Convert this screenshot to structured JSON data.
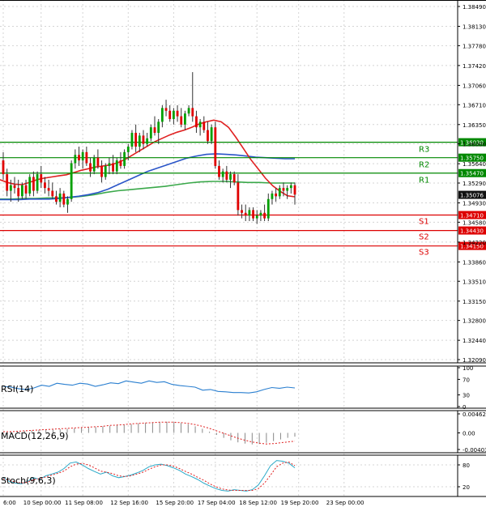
{
  "colors": {
    "up": "#00a000",
    "down": "#e00000",
    "wick": "#333333",
    "ma_fast": "#e02020",
    "ma_mid": "#2a55c8",
    "ma_slow": "#3aa84a",
    "resistance": "#008800",
    "support": "#dd0000",
    "rsi": "#2a7fd0",
    "macd_hist": "#888888",
    "macd_signal": "#e02020",
    "stoch_k": "#2aa9c8",
    "stoch_d": "#e02020",
    "grid": "#d4d4d4",
    "current_price_bg": "#111111"
  },
  "chart_data": [
    {
      "type": "candlestick",
      "title": "",
      "ylim": [
        1.3209,
        1.3849
      ],
      "y_ticks": [
        "1.38490",
        "1.38130",
        "1.37780",
        "1.37420",
        "1.37060",
        "1.36710",
        "1.36350",
        "1.36000",
        "1.35640",
        "1.35290",
        "1.34930",
        "1.34580",
        "1.34220",
        "1.33860",
        "1.33510",
        "1.33150",
        "1.32800",
        "1.32440",
        "1.32090"
      ],
      "x_ticks": [
        "6:00",
        "10 Sep 00:00",
        "11 Sep 08:00",
        "12 Sep 16:00",
        "15 Sep 20:00",
        "17 Sep 04:00",
        "18 Sep 12:00",
        "19 Sep 20:00",
        "23 Sep 00:00"
      ],
      "x_tick_index": [
        0,
        10,
        21,
        33,
        45,
        56,
        67,
        78,
        90
      ],
      "current_price": "1.35076",
      "levels": [
        {
          "name": "R3",
          "value": 1.3603,
          "label": "1.36030",
          "kind": "resistance"
        },
        {
          "name": "R2",
          "value": 1.3575,
          "label": "1.35750",
          "kind": "resistance"
        },
        {
          "name": "R1",
          "value": 1.3547,
          "label": "1.35470",
          "kind": "resistance"
        },
        {
          "name": "S1",
          "value": 1.3471,
          "label": "1.34710",
          "kind": "support"
        },
        {
          "name": "S2",
          "value": 1.3443,
          "label": "1.34430",
          "kind": "support"
        },
        {
          "name": "S3",
          "value": 1.3415,
          "label": "1.34150",
          "kind": "support"
        }
      ],
      "candles": [
        [
          1.357,
          1.3585,
          1.3535,
          1.3545
        ],
        [
          1.3545,
          1.3555,
          1.3505,
          1.3515
        ],
        [
          1.3515,
          1.3535,
          1.3495,
          1.3525
        ],
        [
          1.3525,
          1.354,
          1.351,
          1.352
        ],
        [
          1.352,
          1.3535,
          1.3495,
          1.3505
        ],
        [
          1.3505,
          1.353,
          1.35,
          1.3525
        ],
        [
          1.3525,
          1.3535,
          1.35,
          1.351
        ],
        [
          1.351,
          1.3545,
          1.3505,
          1.354
        ],
        [
          1.354,
          1.355,
          1.3505,
          1.3515
        ],
        [
          1.3515,
          1.355,
          1.351,
          1.3545
        ],
        [
          1.3545,
          1.356,
          1.352,
          1.353
        ],
        [
          1.353,
          1.354,
          1.351,
          1.352
        ],
        [
          1.352,
          1.3535,
          1.3505,
          1.3515
        ],
        [
          1.3515,
          1.353,
          1.35,
          1.3505
        ],
        [
          1.3505,
          1.3515,
          1.349,
          1.3495
        ],
        [
          1.3495,
          1.352,
          1.3485,
          1.351
        ],
        [
          1.351,
          1.3515,
          1.3485,
          1.349
        ],
        [
          1.349,
          1.3505,
          1.3475,
          1.35
        ],
        [
          1.35,
          1.357,
          1.3495,
          1.3565
        ],
        [
          1.3565,
          1.359,
          1.3555,
          1.358
        ],
        [
          1.358,
          1.3595,
          1.356,
          1.357
        ],
        [
          1.357,
          1.359,
          1.3555,
          1.3585
        ],
        [
          1.3585,
          1.3595,
          1.356,
          1.3565
        ],
        [
          1.3565,
          1.3575,
          1.354,
          1.355
        ],
        [
          1.355,
          1.358,
          1.3545,
          1.3575
        ],
        [
          1.3575,
          1.359,
          1.3555,
          1.356
        ],
        [
          1.356,
          1.357,
          1.353,
          1.354
        ],
        [
          1.354,
          1.3565,
          1.3535,
          1.356
        ],
        [
          1.356,
          1.3575,
          1.3545,
          1.3565
        ],
        [
          1.3565,
          1.358,
          1.3545,
          1.355
        ],
        [
          1.355,
          1.3575,
          1.3545,
          1.357
        ],
        [
          1.357,
          1.3585,
          1.3555,
          1.356
        ],
        [
          1.356,
          1.359,
          1.3555,
          1.3585
        ],
        [
          1.3585,
          1.36,
          1.357,
          1.3595
        ],
        [
          1.3595,
          1.3625,
          1.359,
          1.362
        ],
        [
          1.362,
          1.3635,
          1.3585,
          1.3595
        ],
        [
          1.3595,
          1.362,
          1.3585,
          1.3615
        ],
        [
          1.3615,
          1.3625,
          1.359,
          1.36
        ],
        [
          1.36,
          1.362,
          1.3595,
          1.361
        ],
        [
          1.361,
          1.3635,
          1.3605,
          1.363
        ],
        [
          1.363,
          1.365,
          1.3615,
          1.362
        ],
        [
          1.362,
          1.3645,
          1.36,
          1.364
        ],
        [
          1.364,
          1.367,
          1.363,
          1.3665
        ],
        [
          1.3665,
          1.368,
          1.365,
          1.366
        ],
        [
          1.366,
          1.367,
          1.364,
          1.3645
        ],
        [
          1.3645,
          1.3665,
          1.3635,
          1.366
        ],
        [
          1.366,
          1.367,
          1.364,
          1.365
        ],
        [
          1.365,
          1.3665,
          1.363,
          1.3635
        ],
        [
          1.3635,
          1.366,
          1.3625,
          1.3655
        ],
        [
          1.3655,
          1.367,
          1.365,
          1.3665
        ],
        [
          1.3665,
          1.373,
          1.364,
          1.365
        ],
        [
          1.365,
          1.366,
          1.362,
          1.363
        ],
        [
          1.363,
          1.3645,
          1.3615,
          1.364
        ],
        [
          1.364,
          1.365,
          1.362,
          1.3625
        ],
        [
          1.3625,
          1.364,
          1.36,
          1.3605
        ],
        [
          1.3605,
          1.3635,
          1.36,
          1.363
        ],
        [
          1.363,
          1.364,
          1.3555,
          1.356
        ],
        [
          1.356,
          1.357,
          1.3535,
          1.354
        ],
        [
          1.354,
          1.3555,
          1.353,
          1.355
        ],
        [
          1.355,
          1.356,
          1.353,
          1.3535
        ],
        [
          1.3535,
          1.355,
          1.352,
          1.3545
        ],
        [
          1.3545,
          1.355,
          1.3525,
          1.353
        ],
        [
          1.353,
          1.3545,
          1.347,
          1.348
        ],
        [
          1.348,
          1.349,
          1.3465,
          1.3475
        ],
        [
          1.3475,
          1.349,
          1.346,
          1.347
        ],
        [
          1.347,
          1.3485,
          1.346,
          1.348
        ],
        [
          1.348,
          1.3485,
          1.346,
          1.3465
        ],
        [
          1.3465,
          1.348,
          1.3455,
          1.347
        ],
        [
          1.347,
          1.348,
          1.346,
          1.3475
        ],
        [
          1.3475,
          1.349,
          1.346,
          1.3465
        ],
        [
          1.3465,
          1.351,
          1.346,
          1.35
        ],
        [
          1.35,
          1.3515,
          1.349,
          1.351
        ],
        [
          1.351,
          1.352,
          1.3495,
          1.3505
        ],
        [
          1.3505,
          1.3525,
          1.35,
          1.352
        ],
        [
          1.352,
          1.353,
          1.3505,
          1.3515
        ],
        [
          1.3515,
          1.3525,
          1.35,
          1.352
        ],
        [
          1.352,
          1.353,
          1.351,
          1.3525
        ],
        [
          1.3525,
          1.353,
          1.349,
          1.3508
        ]
      ],
      "ma_fast": [
        1.3535,
        1.353,
        1.3527,
        1.3526,
        1.353,
        1.3535,
        1.3538,
        1.354,
        1.3542,
        1.3544,
        1.3548,
        1.3552,
        1.3555,
        1.3558,
        1.356,
        1.3562,
        1.3566,
        1.3572,
        1.358,
        1.3588,
        1.3596,
        1.3604,
        1.361,
        1.3616,
        1.3621,
        1.3625,
        1.363,
        1.3636,
        1.364,
        1.3643,
        1.364,
        1.363,
        1.3612,
        1.3592,
        1.3572,
        1.3555,
        1.3538,
        1.3524,
        1.3514,
        1.3506,
        1.3504
      ],
      "ma_mid": [
        1.3499,
        1.3499,
        1.3499,
        1.35,
        1.35,
        1.35,
        1.3501,
        1.3503,
        1.3505,
        1.3508,
        1.3512,
        1.3518,
        1.3526,
        1.3534,
        1.3542,
        1.355,
        1.3556,
        1.3562,
        1.3568,
        1.3574,
        1.3578,
        1.3581,
        1.3582,
        1.3581,
        1.358,
        1.3578,
        1.3576,
        1.3575,
        1.3574,
        1.3573,
        1.3573
      ],
      "ma_slow": [
        1.35,
        1.35,
        1.3501,
        1.3501,
        1.3502,
        1.3502,
        1.3503,
        1.3505,
        1.3508,
        1.3512,
        1.3515,
        1.3517,
        1.3519,
        1.3521,
        1.3523,
        1.3526,
        1.3529,
        1.3531,
        1.3532,
        1.3532,
        1.3531,
        1.353,
        1.353,
        1.3529,
        1.3529,
        1.3529
      ]
    },
    {
      "type": "line",
      "name": "RSI(14)",
      "ylim": [
        0,
        100
      ],
      "y_ticks": [
        "100",
        "70",
        "30",
        "0"
      ],
      "values": [
        52,
        50,
        46,
        44,
        48,
        55,
        52,
        60,
        57,
        55,
        60,
        58,
        52,
        56,
        61,
        59,
        66,
        63,
        60,
        66,
        62,
        64,
        57,
        54,
        52,
        50,
        42,
        44,
        39,
        38,
        36,
        36,
        35,
        38,
        44,
        49,
        47,
        50,
        48
      ]
    },
    {
      "type": "bar",
      "name": "MACD(12,26,9)",
      "ylim": [
        -0.004034,
        0.004622
      ],
      "y_ticks": [
        "0.004622",
        "0.00",
        "-0.004034"
      ],
      "histogram": [
        0.0002,
        0.0003,
        0.0004,
        0.0005,
        0.0006,
        0.0007,
        0.0008,
        0.0008,
        0.0009,
        0.001,
        0.0011,
        0.0012,
        0.0013,
        0.0014,
        0.0016,
        0.0017,
        0.0019,
        0.002,
        0.0021,
        0.0023,
        0.0024,
        0.0025,
        0.0026,
        0.0027,
        0.0026,
        0.0024,
        0.0021,
        0.0016,
        0.001,
        0.0003,
        -0.0005,
        -0.0012,
        -0.0018,
        -0.0023,
        -0.0026,
        -0.0028,
        -0.0027,
        -0.0024,
        -0.002,
        -0.0016,
        -0.0012,
        -0.0009
      ],
      "signal": [
        0.0003,
        0.0003,
        0.0004,
        0.0005,
        0.0006,
        0.0007,
        0.0008,
        0.0009,
        0.001,
        0.0011,
        0.0012,
        0.0013,
        0.0014,
        0.0015,
        0.0016,
        0.0018,
        0.0019,
        0.002,
        0.0022,
        0.0023,
        0.0024,
        0.0025,
        0.0026,
        0.0026,
        0.0026,
        0.0025,
        0.0023,
        0.002,
        0.0016,
        0.0011,
        0.0005,
        -0.0001,
        -0.0007,
        -0.0013,
        -0.0018,
        -0.0022,
        -0.0025,
        -0.0027,
        -0.0026,
        -0.0024,
        -0.0022,
        -0.002
      ]
    },
    {
      "type": "line",
      "name": "Stoch(9,6,3)",
      "ylim": [
        0,
        100
      ],
      "y_ticks": [
        "80",
        "20"
      ],
      "k": [
        45,
        35,
        30,
        28,
        35,
        45,
        40,
        50,
        55,
        60,
        70,
        85,
        88,
        80,
        70,
        62,
        55,
        60,
        50,
        45,
        48,
        52,
        58,
        65,
        75,
        80,
        82,
        78,
        72,
        65,
        55,
        48,
        40,
        30,
        22,
        15,
        10,
        8,
        12,
        10,
        8,
        12,
        25,
        50,
        78,
        92,
        90,
        85,
        72
      ],
      "d": [
        42,
        38,
        33,
        30,
        33,
        40,
        42,
        47,
        52,
        57,
        63,
        75,
        82,
        84,
        80,
        72,
        63,
        60,
        56,
        50,
        48,
        50,
        55,
        60,
        68,
        75,
        80,
        80,
        77,
        70,
        62,
        55,
        46,
        38,
        28,
        20,
        14,
        11,
        10,
        10,
        10,
        10,
        15,
        30,
        52,
        75,
        85,
        88,
        78
      ]
    }
  ]
}
